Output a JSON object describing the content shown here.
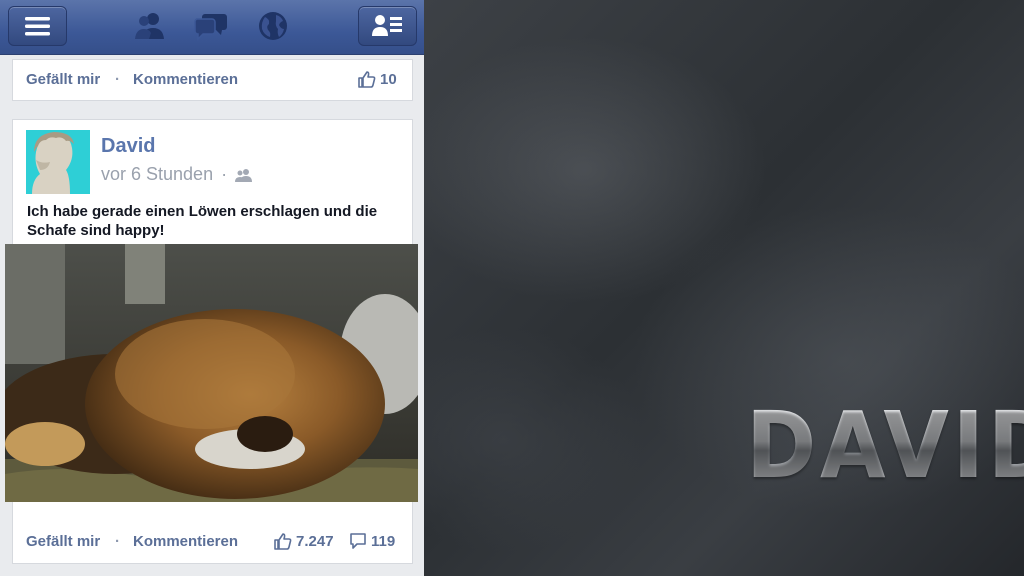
{
  "top_post": {
    "like_label": "Gefällt mir",
    "separator": "·",
    "comment_label": "Kommentieren",
    "like_count": "10"
  },
  "post": {
    "author": "David",
    "time": "vor 6 Stunden",
    "separator": "·",
    "audience_icon": "friends-icon",
    "text": "Ich habe gerade einen Löwen erschlagen und die Schafe sind happy!",
    "like_label": "Gefällt mir",
    "comment_label": "Kommentieren",
    "like_count": "7.247",
    "comment_count": "119"
  },
  "nav_icons": [
    "menu-icon",
    "friend-requests-icon",
    "messages-icon",
    "notifications-globe-icon",
    "profile-card-icon"
  ],
  "brand_title": "DAVID",
  "colors": {
    "top_bar": "#3c5897",
    "link": "#5b6f97",
    "author": "#5a76ad",
    "slate": "#2c3034"
  }
}
